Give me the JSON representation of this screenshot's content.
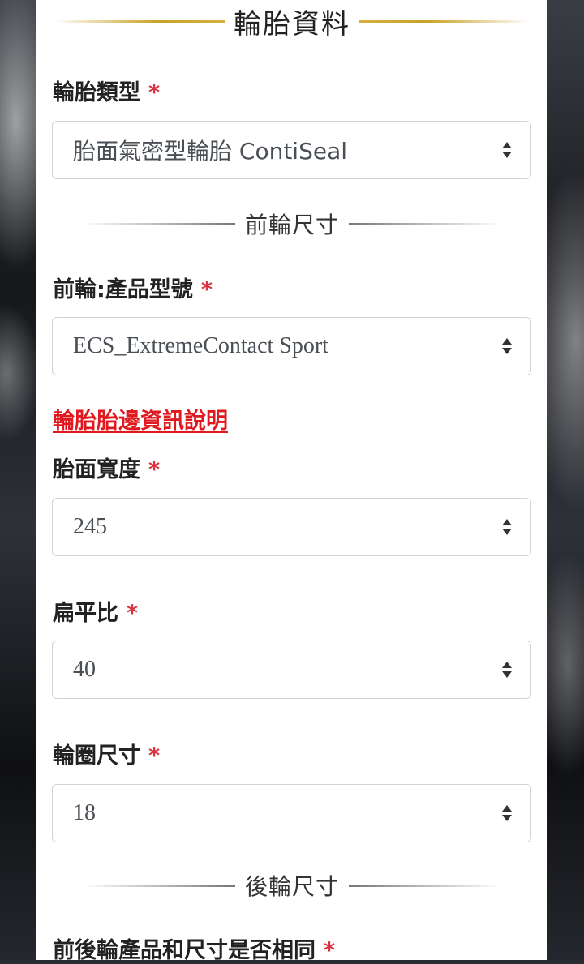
{
  "section_title": "輪胎資料",
  "tire_type": {
    "label": "輪胎類型",
    "required_mark": "*",
    "value": "胎面氣密型輪胎 ContiSeal"
  },
  "front_section": {
    "title": "前輪尺寸"
  },
  "front_product": {
    "label": "前輪:產品型號",
    "required_mark": "*",
    "value": "ECS_ExtremeContact Sport"
  },
  "sidewall_link": {
    "text": "輪胎胎邊資訊說明",
    "color": "#e0191f"
  },
  "tread_width": {
    "label": "胎面寬度",
    "required_mark": "*",
    "value": "245"
  },
  "aspect_ratio": {
    "label": "扁平比",
    "required_mark": "*",
    "value": "40"
  },
  "rim_size": {
    "label": "輪圈尺寸",
    "required_mark": "*",
    "value": "18"
  },
  "rear_section": {
    "title": "後輪尺寸"
  },
  "same_question": {
    "label": "前後輪產品和尺寸是否相同",
    "required_mark": "*"
  },
  "colors": {
    "accent_gold": "#c9a227",
    "required_red": "#d9333f"
  },
  "icons": {
    "select_arrow": "sort-updown-icon"
  }
}
